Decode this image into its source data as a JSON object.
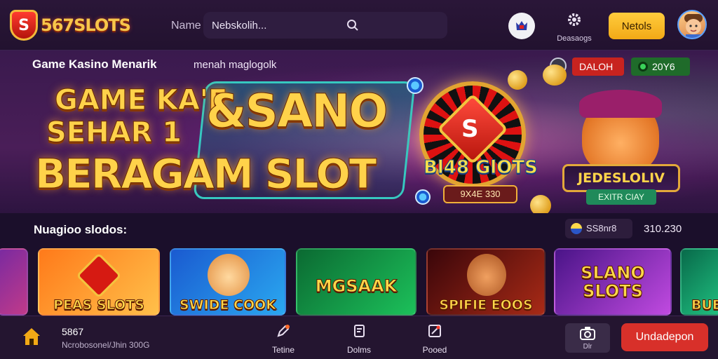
{
  "header": {
    "logo_badge": "S",
    "logo_text": "567SLOTS",
    "search_label": "Name",
    "search_value": "Nebskolih...",
    "settings_label": "Deasaogs",
    "primary_button": "Netols"
  },
  "hero": {
    "heading": "Game Kasino Menarik",
    "subheading": "menah maglogolk",
    "title_line1": "GAME KA'E",
    "title_line2": "SEHAR 1",
    "title_big": "&SANO",
    "title_line3": "BERAGAM SLOT",
    "wheel_label": "Bl48 GlOTS",
    "wheel_tag": "9X4E 330",
    "pill_red": "DALOH",
    "pill_green": "20Y6",
    "mascot_plate": "JEDESLOLIV",
    "mascot_tag": "EXITR CIAY"
  },
  "section": {
    "label": "Nuagioo slodos:",
    "balance_label": "SS8nr8",
    "balance_value": "310.230"
  },
  "cards": [
    {
      "title": "",
      "colors": [
        "#7a2aa0",
        "#c03a8a"
      ]
    },
    {
      "title": "PEAS SLOTS",
      "colors": [
        "#ff8a2a",
        "#ffb24a"
      ]
    },
    {
      "title": "SWIDE COOK",
      "colors": [
        "#1a6ad0",
        "#2aa8f0"
      ]
    },
    {
      "title": "MGSAAK",
      "colors": [
        "#0d7a3a",
        "#1ab050"
      ]
    },
    {
      "title": "SPIFIE EOOS",
      "colors": [
        "#5a0c10",
        "#b02a18"
      ]
    },
    {
      "title": "SLANO SLOTS",
      "colors": [
        "#5a1a9a",
        "#c050e0"
      ]
    },
    {
      "title": "BUE",
      "colors": [
        "#0a7a5a",
        "#20c080"
      ]
    }
  ],
  "bottom_nav": {
    "title": "5867",
    "subtitle": "Ncrobosonel/Jhin 300G",
    "items": [
      "Tetine",
      "Dolms",
      "Pooed"
    ],
    "camera_label": "Dlr",
    "cta_button": "Undadepon"
  },
  "colors": {
    "accent": "#ffcc3d",
    "cta": "#d8302a",
    "bg": "#1b0f2b"
  }
}
